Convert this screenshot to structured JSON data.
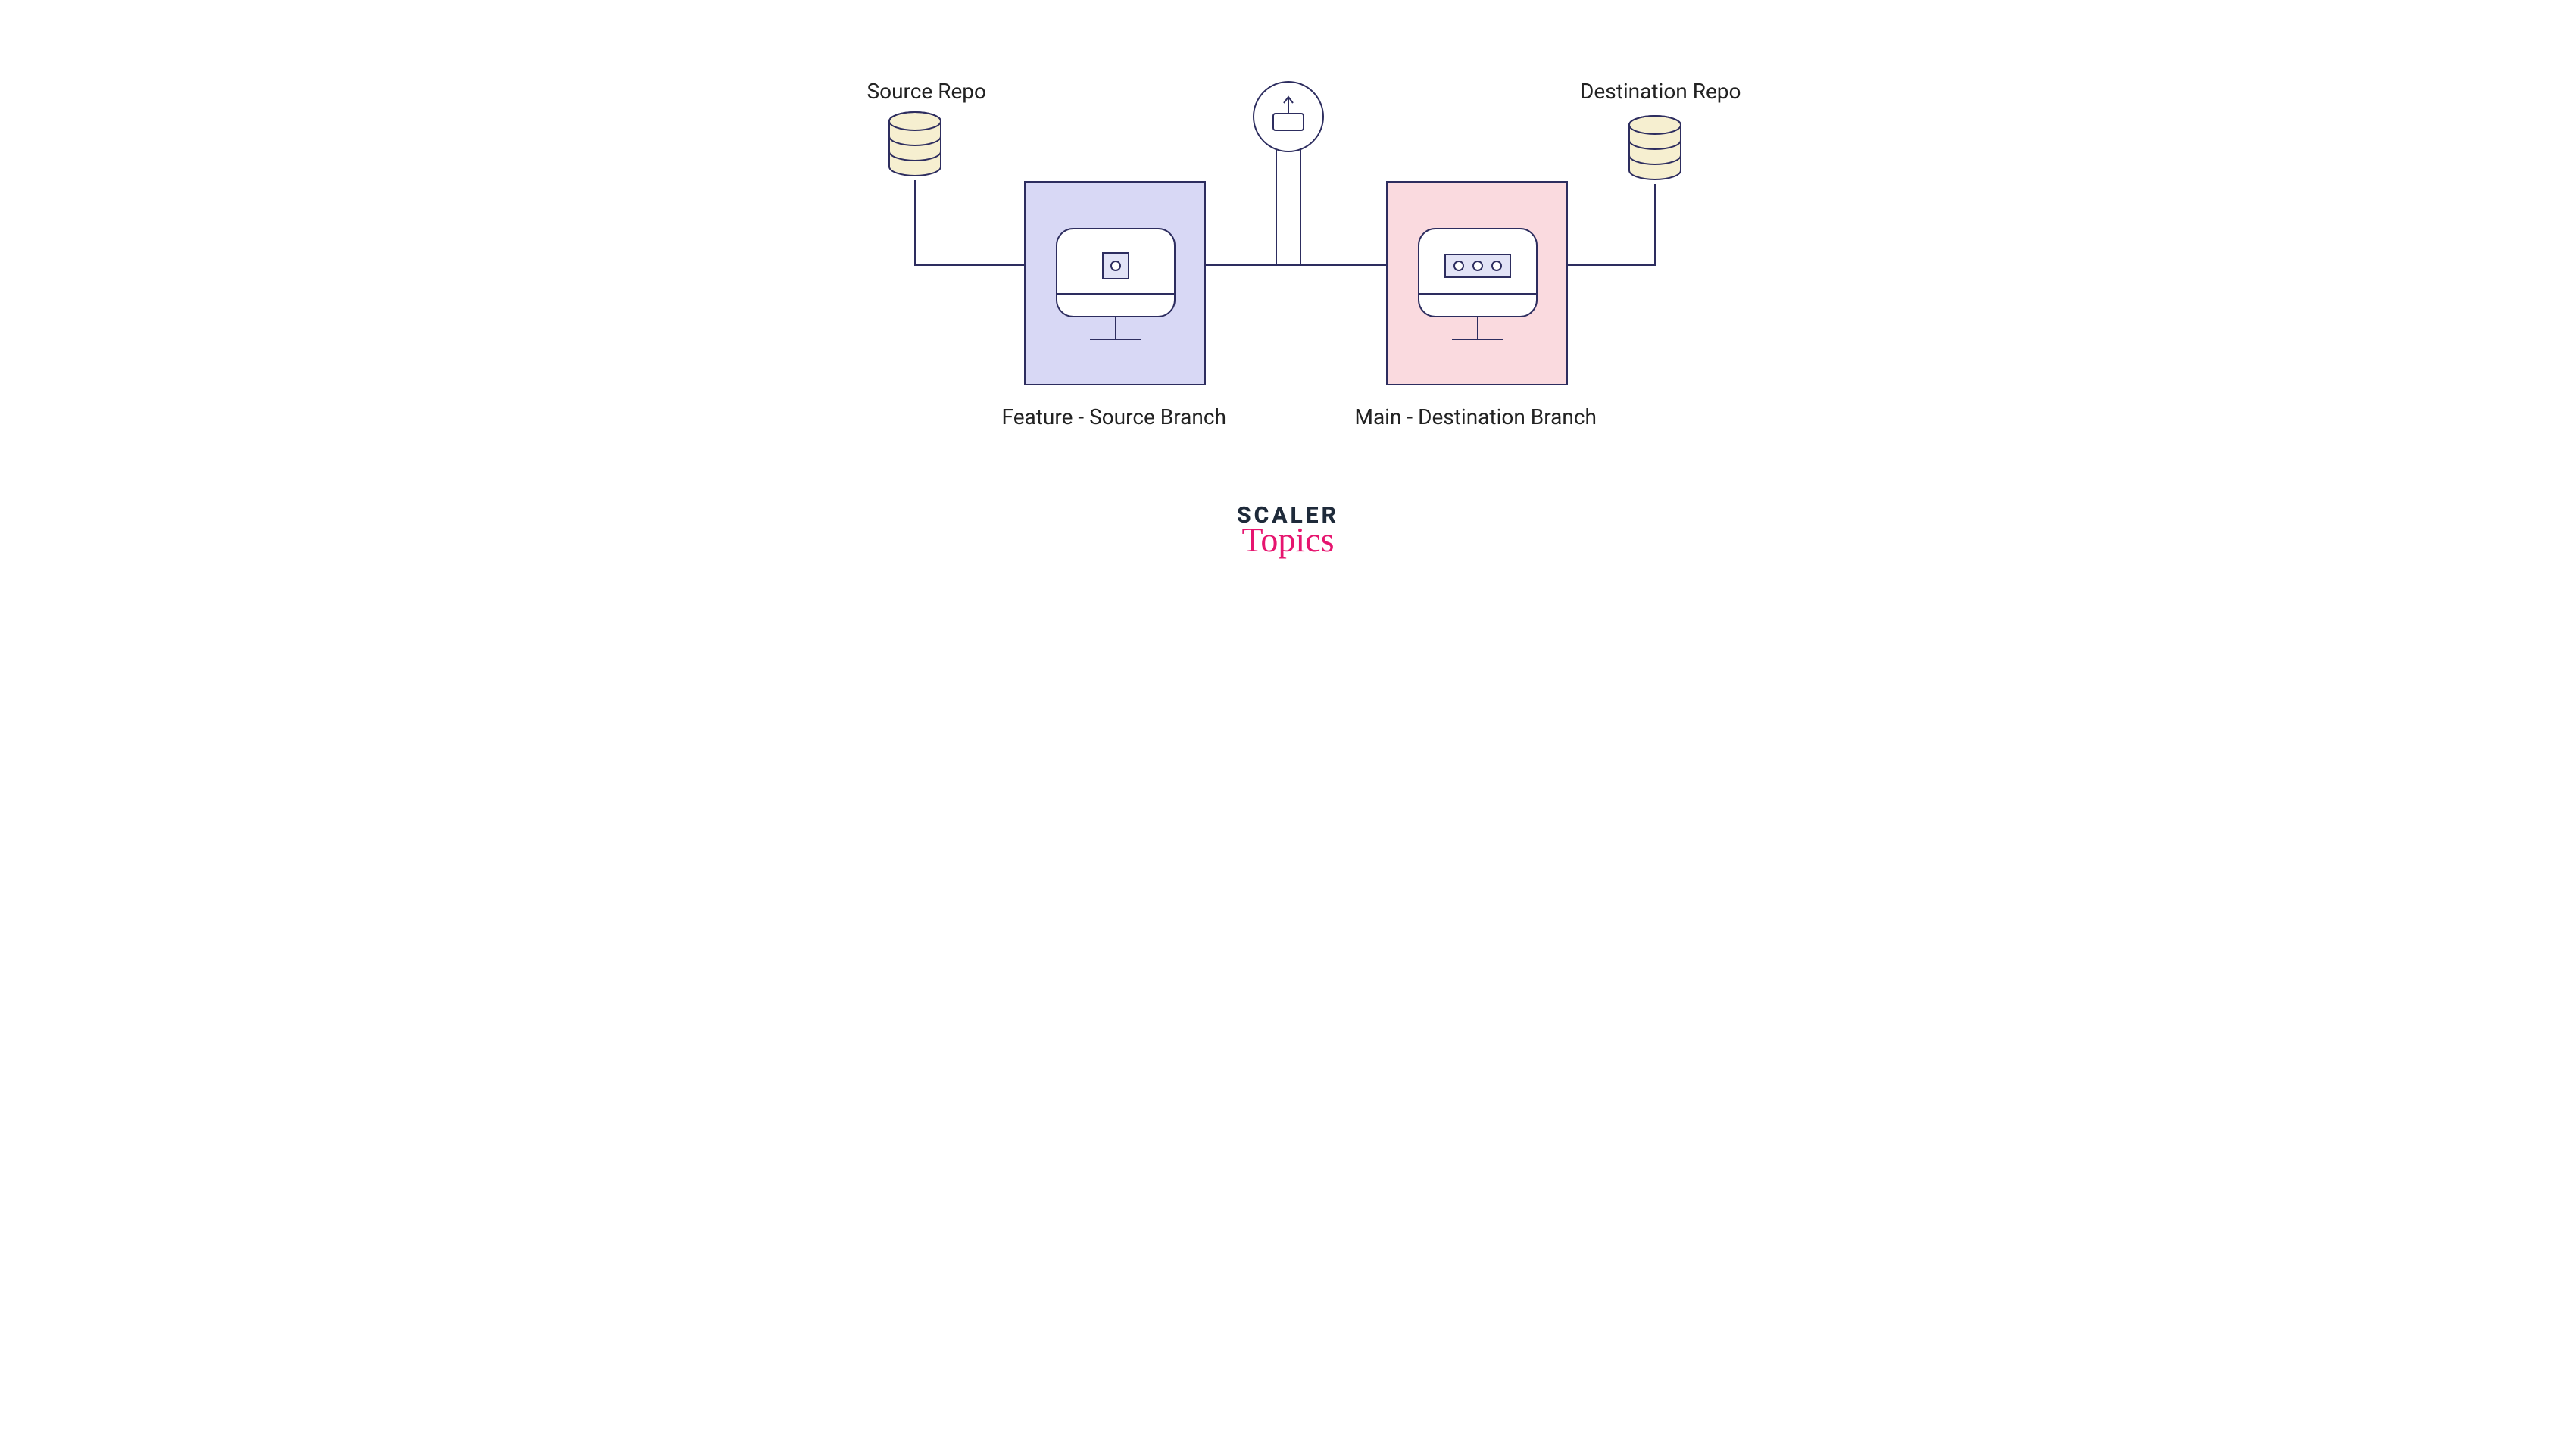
{
  "labels": {
    "source_repo": "Source Repo",
    "destination_repo": "Destination Repo",
    "feature_branch": "Feature - Source Branch",
    "main_branch": "Main - Destination Branch"
  },
  "logo": {
    "line1": "SCALER",
    "line2": "Topics"
  },
  "colors": {
    "outline": "#2d2d5f",
    "feature_fill": "#d8d8f5",
    "main_fill": "#fadadf",
    "cylinder_fill": "#f6efd0",
    "monitor_inner_fill": "#e2e3f6",
    "white": "#ffffff",
    "pink_accent": "#e6156f",
    "logo_dark": "#1e2a3a"
  }
}
